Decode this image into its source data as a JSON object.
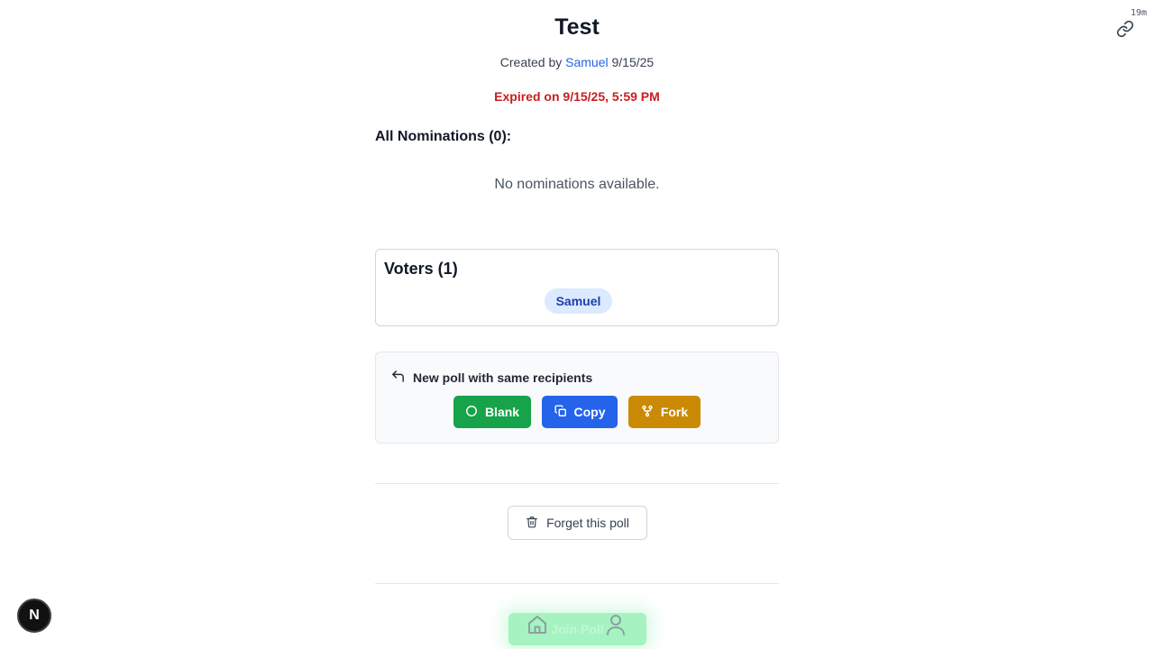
{
  "header": {
    "timer": "19m",
    "link_icon": "link-icon"
  },
  "poll": {
    "title": "Test",
    "created_prefix": "Created by",
    "author": "Samuel",
    "created_date": "9/15/25",
    "expired_text": "Expired on 9/15/25, 5:59 PM"
  },
  "nominations": {
    "heading": "All Nominations (0):",
    "empty_text": "No nominations available."
  },
  "voters": {
    "title": "Voters (1)",
    "names": [
      "Samuel"
    ]
  },
  "new_poll": {
    "heading": "New poll with same recipients",
    "buttons": {
      "blank": "Blank",
      "copy": "Copy",
      "fork": "Fork"
    }
  },
  "forget": {
    "label": "Forget this poll"
  },
  "bottom_nav": {
    "label": "Join Poll",
    "icons": [
      "home-icon",
      "user-icon"
    ]
  },
  "dev_badge": {
    "label": "N"
  },
  "colors": {
    "expired": "#c81e1e",
    "link": "#2563eb",
    "blank_button": "#16a34a",
    "copy_button": "#2563eb",
    "fork_button": "#ca8a04",
    "voter_chip_bg": "#dbeafe"
  }
}
